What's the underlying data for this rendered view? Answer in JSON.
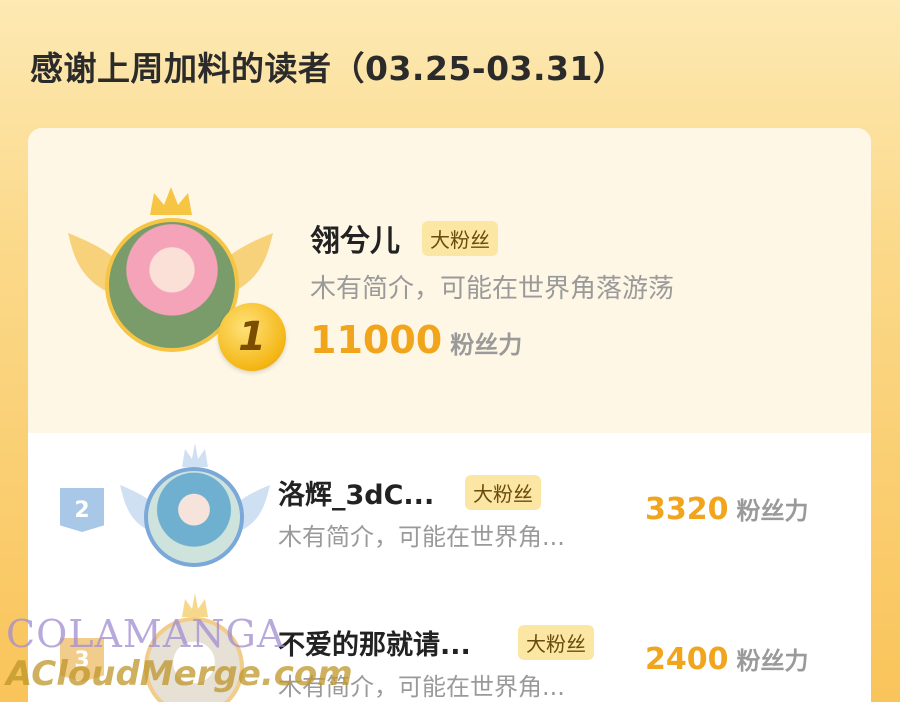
{
  "page": {
    "title": "感谢上周加料的读者（03.25-03.31）"
  },
  "colors": {
    "accent": "#f0a51c",
    "tag_bg": "#fbe7a3",
    "rank2": "#a9c7e6",
    "rank3": "#f1cc8a"
  },
  "readers": [
    {
      "rank": "1",
      "name": "翎兮儿",
      "tag": "大粉丝",
      "intro": "木有简介，可能在世界角落游荡",
      "score": "11000",
      "unit": "粉丝力",
      "icon": "gold-rank-medal-icon"
    },
    {
      "rank": "2",
      "name": "洛辉_3dC...",
      "tag": "大粉丝",
      "intro": "木有简介，可能在世界角...",
      "score": "3320",
      "unit": "粉丝力",
      "icon": "silver-rank-badge-icon"
    },
    {
      "rank": "3",
      "name": "不爱的那就请...",
      "tag": "大粉丝",
      "intro": "木有简介，可能在世界角...",
      "score": "2400",
      "unit": "粉丝力",
      "icon": "bronze-rank-badge-icon"
    }
  ],
  "watermark": {
    "line1": "COLAMANGA",
    "line2": "ACloudMerge.com"
  }
}
